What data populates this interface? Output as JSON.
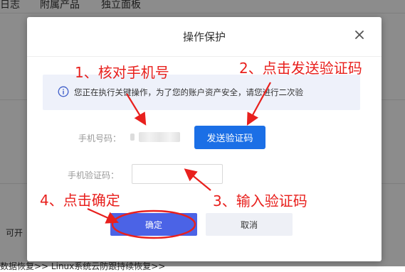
{
  "background": {
    "tabs": [
      "日志",
      "附属产品",
      "独立面板"
    ],
    "left_text": "可开",
    "bottom_text": "数据恢复>>    Linux系统云防跟持续恢复>>"
  },
  "dialog": {
    "title": "操作保护",
    "notice": "您正在执行关键操作，为了您的账户资产安全，请您进行二次验",
    "phone_label": "手机号码：",
    "send_code_button": "发送验证码",
    "code_label": "手机验证码：",
    "code_input_value": "",
    "confirm_button": "确定",
    "cancel_button": "取消"
  },
  "annotations": {
    "step1": "1、核对手机号",
    "step2": "2、点击发送验证码",
    "step3": "3、输入验证码",
    "step4": "4、点击确定",
    "color": "#e8201d"
  },
  "colors": {
    "primary": "#1b6fe6",
    "confirm": "#4b63e6",
    "notice_bg": "#eef1fa"
  },
  "icons": [
    "close-icon",
    "info-icon"
  ]
}
